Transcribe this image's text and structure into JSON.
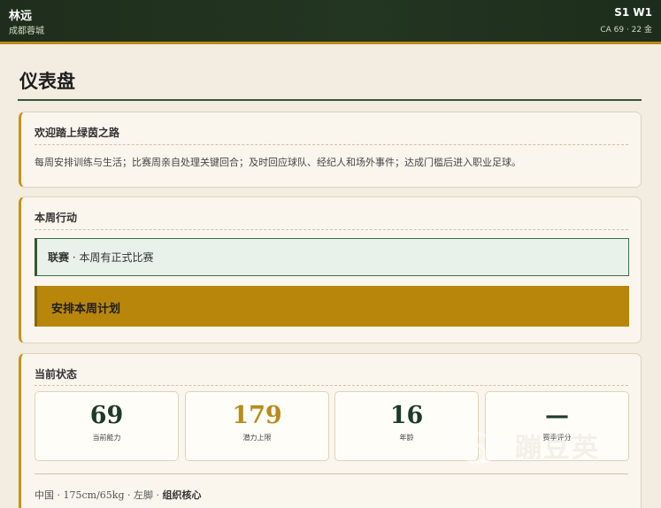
{
  "header": {
    "player_name": "林远",
    "club": "成都蓉城",
    "season_week": "S1 W1",
    "meta": "CA 69 · 22 金"
  },
  "page": {
    "title": "仪表盘"
  },
  "welcome": {
    "title": "欢迎踏上绿茵之路",
    "text": "每周安排训练与生活；比赛周亲自处理关键回合；及时回应球队、经纪人和场外事件；达成门槛后进入职业足球。"
  },
  "week": {
    "title": "本周行动",
    "match_label": "联赛",
    "match_sep": " · ",
    "match_text": "本周有正式比赛",
    "plan_button": "安排本周计划"
  },
  "status": {
    "title": "当前状态",
    "stats": [
      {
        "value": "69",
        "label": "当前能力"
      },
      {
        "value": "179",
        "label": "潜力上限"
      },
      {
        "value": "16",
        "label": "年龄"
      },
      {
        "value": "—",
        "label": "赛季评分"
      }
    ],
    "profile": "中国 · 175cm/65kg · 左脚 · ",
    "role": "组织核心"
  },
  "watermark": {
    "text": "蹦豆英"
  },
  "colors": {
    "accent_gold": "#b8860b",
    "header_green": "#1f2e1c",
    "card_border": "#c4941b"
  }
}
